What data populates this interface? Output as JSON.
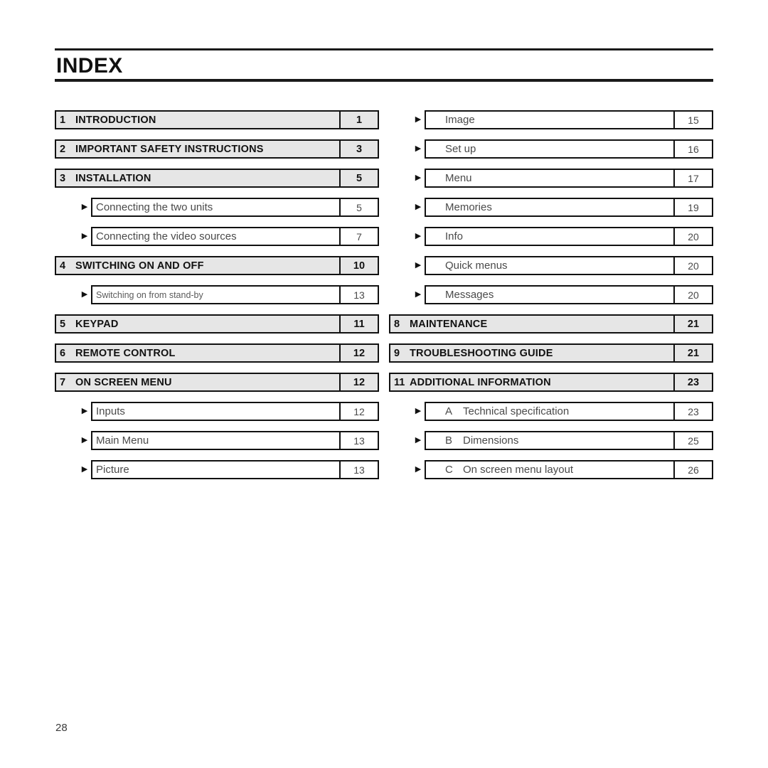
{
  "document": {
    "title": "INDEX",
    "footer_page_number": "28",
    "arrow_icon": "▶"
  },
  "colors": {
    "main_row_fill": "#e6e6e6",
    "border": "#111111",
    "main_text": "#111111",
    "sub_text": "#4a4a4a",
    "rule": "#1a1a1a"
  },
  "left_column": {
    "rows": [
      {
        "kind": "main",
        "number": "1",
        "label": "INTRODUCTION",
        "page": "1"
      },
      {
        "kind": "main",
        "number": "2",
        "label": "IMPORTANT SAFETY INSTRUCTIONS",
        "page": "3"
      },
      {
        "kind": "main",
        "number": "3",
        "label": "INSTALLATION",
        "page": "5"
      },
      {
        "kind": "sub",
        "label": "Connecting the two units",
        "page": "5"
      },
      {
        "kind": "sub",
        "label": "Connecting the video sources",
        "page": "7"
      },
      {
        "kind": "main",
        "number": "4",
        "label": "SWITCHING ON AND OFF",
        "page": "10"
      },
      {
        "kind": "sub",
        "label": "Switching on from stand-by",
        "page": "13",
        "small": true
      },
      {
        "kind": "main",
        "number": "5",
        "label": "KEYPAD",
        "page": "11"
      },
      {
        "kind": "main",
        "number": "6",
        "label": "REMOTE CONTROL",
        "page": "12"
      },
      {
        "kind": "main",
        "number": "7",
        "label": "ON SCREEN MENU",
        "page": "12"
      },
      {
        "kind": "sub",
        "label": "Inputs",
        "page": "12"
      },
      {
        "kind": "sub",
        "label": "Main Menu",
        "page": "13"
      },
      {
        "kind": "sub",
        "label": "Picture",
        "page": "13"
      }
    ]
  },
  "right_column": {
    "rows": [
      {
        "kind": "sub",
        "label": "Image",
        "page": "15"
      },
      {
        "kind": "sub",
        "label": "Set up",
        "page": "16"
      },
      {
        "kind": "sub",
        "label": "Menu",
        "page": "17"
      },
      {
        "kind": "sub",
        "label": "Memories",
        "page": "19"
      },
      {
        "kind": "sub",
        "label": "Info",
        "page": "20"
      },
      {
        "kind": "sub",
        "label": "Quick menus",
        "page": "20"
      },
      {
        "kind": "sub",
        "label": "Messages",
        "page": "20"
      },
      {
        "kind": "main",
        "number": "8",
        "label": "MAINTENANCE",
        "page": "21"
      },
      {
        "kind": "main",
        "number": "9",
        "label": "TROUBLESHOOTING GUIDE",
        "page": "21"
      },
      {
        "kind": "main",
        "number": "11",
        "label": "ADDITIONAL INFORMATION",
        "page": "23"
      },
      {
        "kind": "sub",
        "letter": "A",
        "label": "Technical specification",
        "page": "23"
      },
      {
        "kind": "sub",
        "letter": "B",
        "label": "Dimensions",
        "page": "25"
      },
      {
        "kind": "sub",
        "letter": "C",
        "label": "On screen menu layout",
        "page": "26"
      }
    ]
  }
}
